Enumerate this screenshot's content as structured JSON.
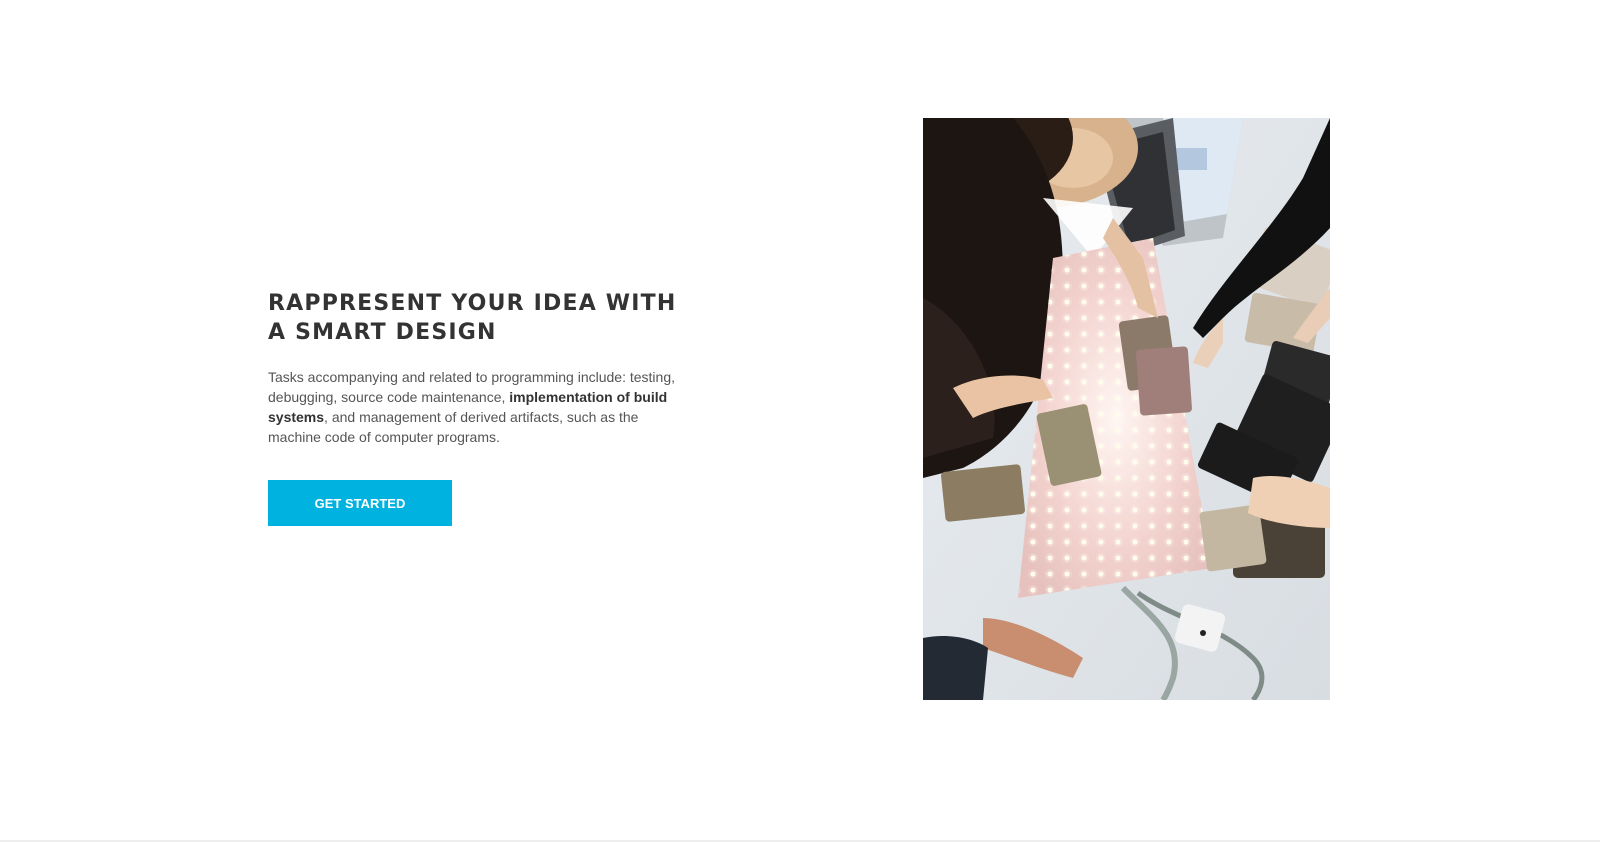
{
  "hero": {
    "title_line1": "RAPPRESENT YOUR IDEA WITH",
    "title_line2": "A SMART DESIGN",
    "description": {
      "part1": "Tasks accompanying and related to programming include: testing, debugging, source code maintenance, ",
      "bold": "implementation of build systems",
      "part2": ", and management of derived artifacts, such as the machine code of computer programs."
    },
    "cta_label": "GET STARTED"
  },
  "colors": {
    "accent": "#00b2e0",
    "heading": "#333333",
    "body_text": "#555555"
  }
}
